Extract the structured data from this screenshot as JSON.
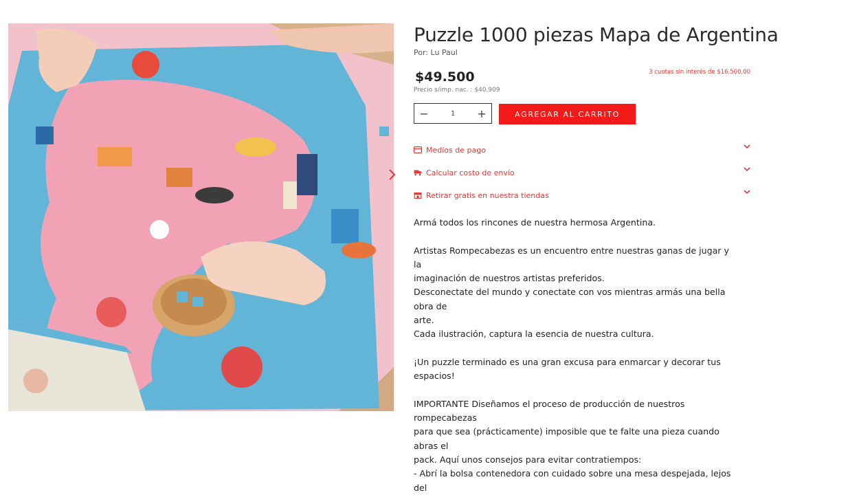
{
  "product": {
    "title": "Puzzle 1000 piezas Mapa de Argentina",
    "byline": "Por: Lu Paul",
    "price": "$49.500",
    "installments": "3 cuotas sin interés de $16.500,00",
    "price_net": "Precio s/imp. nac. : $40.909"
  },
  "quantity": {
    "value": "1",
    "minus": "−",
    "plus": "+"
  },
  "add_to_cart_label": "AGREGAR AL CARRITO",
  "accordions": [
    {
      "label": "Medios de pago",
      "icon": "credit-card-icon"
    },
    {
      "label": "Calcular costo de envío",
      "icon": "truck-icon"
    },
    {
      "label": "Retirar gratis en nuestra tiendas",
      "icon": "store-icon"
    }
  ],
  "description": {
    "p1": "Armá todos los rincones de nuestra hermosa Argentina.",
    "p2": "Artistas Rompecabezas es un encuentro entre nuestras ganas de jugar y la",
    "p3": "imaginación de nuestros artistas preferidos.",
    "p4": "Desconectate del mundo y conectate con vos mientras armás una bella obra de",
    "p5": "arte.",
    "p6": "Cada ilustración, captura la esencia de nuestra cultura.",
    "p7": "¡Un puzzle terminado es una gran excusa para enmarcar y decorar tus espacios!",
    "p8": "IMPORTANTE Diseñamos el proceso de producción de nuestros rompecabezas",
    "p9": "para que sea (prácticamente) imposible que te falte una pieza cuando abras el",
    "p10": "pack. Aquí unos consejos para evitar contratiempos:",
    "p11": "- Abrí la bolsa contenedora con cuidado sobre una mesa despejada, lejos del"
  },
  "colors": {
    "accent": "#f41a1a",
    "link_red": "#e53935",
    "puzzle_pink": "#f3b6c3",
    "puzzle_blue": "#5fb4d6",
    "table_wood": "#c9a27a"
  }
}
